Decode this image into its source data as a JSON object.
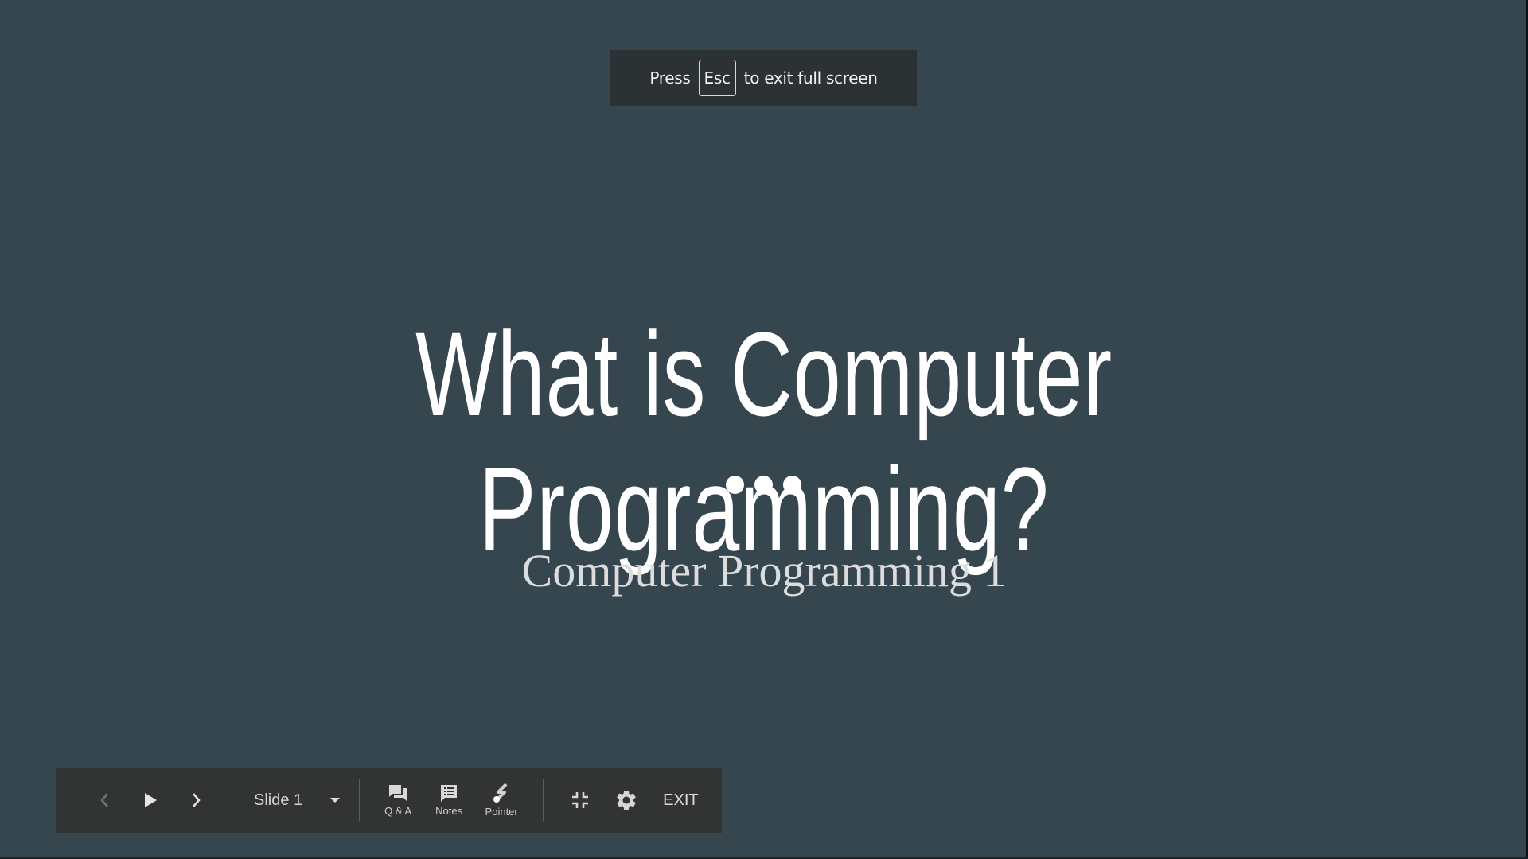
{
  "fullscreen_notice": {
    "prefix": "Press",
    "key": "Esc",
    "suffix": "to exit full screen"
  },
  "slide": {
    "title": "What is Computer Programming?",
    "subtitle": "Computer Programming 1",
    "decoration_icon": "three-dots-icon"
  },
  "toolbar": {
    "prev_icon": "chevron-left-icon",
    "play_icon": "play-icon",
    "next_icon": "chevron-right-icon",
    "slide_selector": {
      "value": "Slide 1",
      "icon": "caret-down-icon"
    },
    "tools": [
      {
        "label": "Q & A",
        "icon": "qa-chat-icon"
      },
      {
        "label": "Notes",
        "icon": "notes-icon"
      },
      {
        "label": "Pointer",
        "icon": "laser-pointer-icon"
      }
    ],
    "exit_fullscreen_icon": "exit-fullscreen-icon",
    "settings_icon": "gear-icon",
    "exit_label": "EXIT"
  },
  "colors": {
    "background": "#36464e",
    "toolbar": "#323434",
    "notice": "#2c3234",
    "title": "#ffffff",
    "subtitle": "#dcdcdc"
  }
}
